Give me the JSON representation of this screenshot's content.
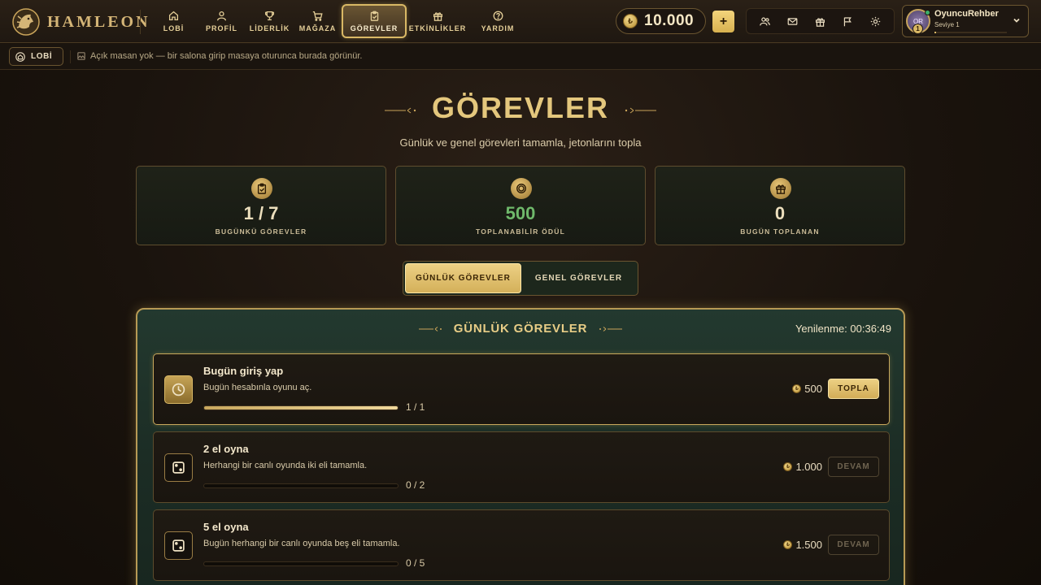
{
  "brand": {
    "name": "HAMLEON"
  },
  "nav": {
    "items": [
      {
        "label": "LOBİ",
        "icon": "home-icon"
      },
      {
        "label": "PROFİL",
        "icon": "user-icon"
      },
      {
        "label": "LİDERLİK",
        "icon": "trophy-icon"
      },
      {
        "label": "MAĞAZA",
        "icon": "cart-icon"
      },
      {
        "label": "GÖREVLER",
        "icon": "clipboard-check-icon",
        "active": true
      },
      {
        "label": "ETKİNLİKLER",
        "icon": "gift-icon"
      },
      {
        "label": "YARDIM",
        "icon": "help-icon"
      }
    ]
  },
  "wallet": {
    "balance": "10.000",
    "add_label": "+"
  },
  "toolbar": {
    "icons": [
      "friends-icon",
      "mail-icon",
      "gift-icon",
      "flag-icon",
      "settings-icon"
    ]
  },
  "profile": {
    "name": "OyuncuRehber",
    "level_text": "Seviye 1",
    "level_badge": "1",
    "avatar_initials": "OR",
    "xp_progress": 0.02
  },
  "breadcrumb": {
    "lobby_label": "LOBİ",
    "message": "Açık masan yok — bir salona girip masaya oturunca burada görünür."
  },
  "page": {
    "title": "GÖREVLER",
    "subtitle": "Günlük ve genel görevleri tamamla, jetonlarını topla"
  },
  "stats": [
    {
      "value": "1 / 7",
      "label": "BUGÜNKÜ GÖREVLER",
      "icon": "clipboard-check-icon"
    },
    {
      "value": "500",
      "label": "TOPLANABİLİR ÖDÜL",
      "icon": "coin-icon"
    },
    {
      "value": "0",
      "label": "BUGÜN TOPLANAN",
      "icon": "gift-icon"
    }
  ],
  "tabs": [
    {
      "label": "GÜNLÜK GÖREVLER",
      "active": true
    },
    {
      "label": "GENEL GÖREVLER",
      "active": false
    }
  ],
  "panel": {
    "title": "GÜNLÜK GÖREVLER",
    "reset_text": "Yenilenme: 00:36:49",
    "tasks": [
      {
        "name": "Bugün giriş yap",
        "description": "Bugün hesabınla oyunu aç.",
        "progress_text": "1 / 1",
        "progress": 1.0,
        "reward": "500",
        "button": "TOPLA",
        "state": "done",
        "icon": "clock-icon"
      },
      {
        "name": "2 el oyna",
        "description": "Herhangi bir canlı oyunda iki eli tamamla.",
        "progress_text": "0 / 2",
        "progress": 0.0,
        "reward": "1.000",
        "button": "DEVAM",
        "state": "pending",
        "icon": "dice-icon"
      },
      {
        "name": "5 el oyna",
        "description": "Bugün herhangi bir canlı oyunda beş eli tamamla.",
        "progress_text": "0 / 5",
        "progress": 0.0,
        "reward": "1.500",
        "button": "DEVAM",
        "state": "pending",
        "icon": "dice-icon"
      }
    ]
  },
  "colors": {
    "accent": "#d9b865",
    "panel_green": "#1f3329",
    "reward_green": "#6fb96b"
  }
}
